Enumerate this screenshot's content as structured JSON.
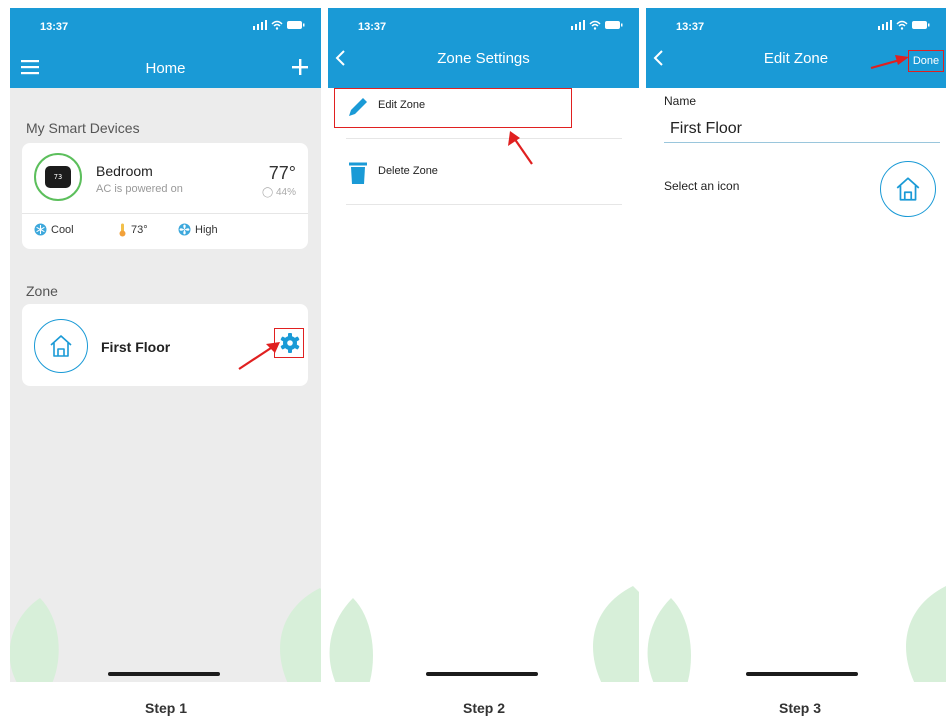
{
  "status_time": "13:37",
  "panel1": {
    "title": "Home",
    "section_devices": "My Smart Devices",
    "device": {
      "screen_text": "73",
      "name": "Bedroom",
      "status": "AC is powered on",
      "temperature": "77°",
      "humidity": "◯ 44%",
      "mode": "Cool",
      "setpoint": "73°",
      "fan": "High"
    },
    "section_zone": "Zone",
    "zone_name": "First Floor"
  },
  "panel2": {
    "title": "Zone Settings",
    "items": [
      {
        "label": "Edit Zone",
        "icon": "pencil-icon"
      },
      {
        "label": "Delete Zone",
        "icon": "trash-icon"
      }
    ]
  },
  "panel3": {
    "title": "Edit Zone",
    "done_label": "Done",
    "name_label": "Name",
    "name_value": "First Floor",
    "icon_label": "Select an icon"
  },
  "steps": [
    "Step 1",
    "Step 2",
    "Step 3"
  ],
  "colors": {
    "brand_blue": "#1a9ad6",
    "highlight_red": "#e02020",
    "leaf_green": "#d7efd9"
  }
}
